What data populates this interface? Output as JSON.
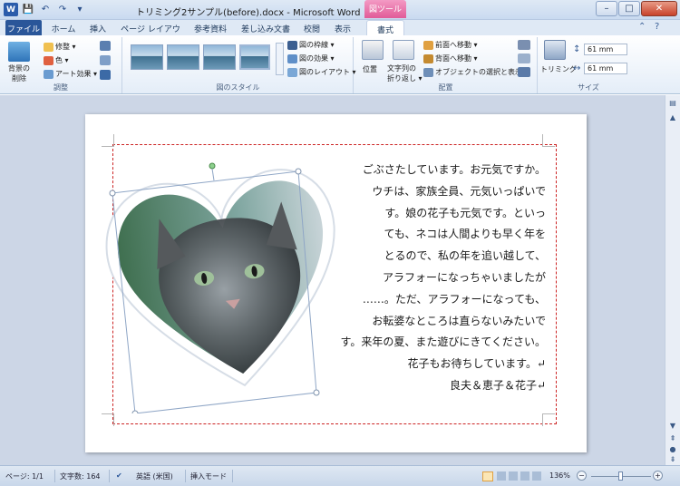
{
  "window": {
    "title": "トリミング2サンプル(before).docx  -  Microsoft Word",
    "context_tab_group": "図ツール",
    "min": "–",
    "max": "□",
    "close": "✕"
  },
  "qat": {
    "app_icon": "W",
    "save_icon": "💾",
    "undo_icon": "↶",
    "redo_icon": "↷",
    "more_icon": "▾"
  },
  "tabs": {
    "file": "ファイル",
    "home": "ホーム",
    "insert": "挿入",
    "layout": "ページ レイアウト",
    "references": "参考資料",
    "mailings": "差し込み文書",
    "review": "校閲",
    "view": "表示",
    "format": "書式"
  },
  "tab_icons": {
    "minimize": "⌃",
    "help": "?"
  },
  "ribbon": {
    "adjust": {
      "remove_bg_1": "背景の",
      "remove_bg_2": "削除",
      "corrections": "修整 ▾",
      "color": "色 ▾",
      "artistic": "アート効果 ▾",
      "label": "調整"
    },
    "styles": {
      "border": "図の枠線 ▾",
      "effects": "図の効果 ▾",
      "layout": "図のレイアウト ▾",
      "label": "図のスタイル"
    },
    "arrange": {
      "position": "位置",
      "wrap_1": "文字列の",
      "wrap_2": "折り返し ▾",
      "forward": "前面へ移動 ▾",
      "backward": "背面へ移動 ▾",
      "selection": "オブジェクトの選択と表示",
      "label": "配置"
    },
    "size": {
      "crop": "トリミング",
      "height": "61 mm",
      "width": "61 mm",
      "label": "サイズ"
    }
  },
  "document": {
    "lines": [
      "ごぶさたしています。お元気ですか。",
      "ウチは、家族全員、元気いっぱいで",
      "す。娘の花子も元気です。といっ",
      "ても、ネコは人間よりも早く年を",
      "とるので、私の年を追い越して、",
      "アラフォーになっちゃいましたが",
      "……。ただ、アラフォーになっても、",
      "お転婆なところは直らないみたいで",
      "す。来年の夏、また遊びにきてください。",
      "花子もお待ちしています。↵",
      "良夫＆恵子＆花子↵"
    ]
  },
  "status": {
    "page": "ページ: 1/1",
    "words": "文字数: 164",
    "lang": "英語 (米国)",
    "mode": "挿入モード",
    "zoom": "136%",
    "zoom_out": "−",
    "zoom_in": "+"
  },
  "colors": {
    "accent": "#2a5699",
    "context": "#e15b98",
    "crop_dash": "#cc2222"
  }
}
